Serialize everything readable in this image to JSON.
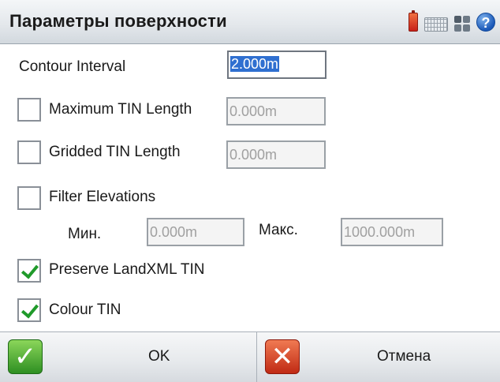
{
  "title": "Параметры поверхности",
  "tray": {
    "battery_icon": "battery-icon",
    "keyboard_icon": "keyboard-icon",
    "grid_icon": "grid-icon",
    "help_icon": "help-icon",
    "help_glyph": "?"
  },
  "form": {
    "contour_interval": {
      "label": "Contour Interval",
      "value": "2.000m"
    },
    "max_tin_length": {
      "label": "Maximum TIN Length",
      "checked": false,
      "value": "0.000m"
    },
    "gridded_tin_length": {
      "label": "Gridded TIN Length",
      "checked": false,
      "value": "0.000m"
    },
    "filter_elevations": {
      "label": "Filter Elevations",
      "checked": false,
      "min_label": "Мин.",
      "min_value": "0.000m",
      "max_label": "Макс.",
      "max_value": "1000.000m"
    },
    "preserve_landxml_tin": {
      "label": "Preserve LandXML TIN",
      "checked": true
    },
    "colour_tin": {
      "label": "Colour TIN",
      "checked": true
    }
  },
  "buttons": {
    "ok": {
      "label": "OK",
      "glyph": "✓"
    },
    "cancel": {
      "label": "Отмена",
      "glyph": "✕"
    }
  },
  "colors": {
    "ok_accent": "#2e8f22",
    "cancel_accent": "#c02a14",
    "selection": "#2f6fd0"
  }
}
